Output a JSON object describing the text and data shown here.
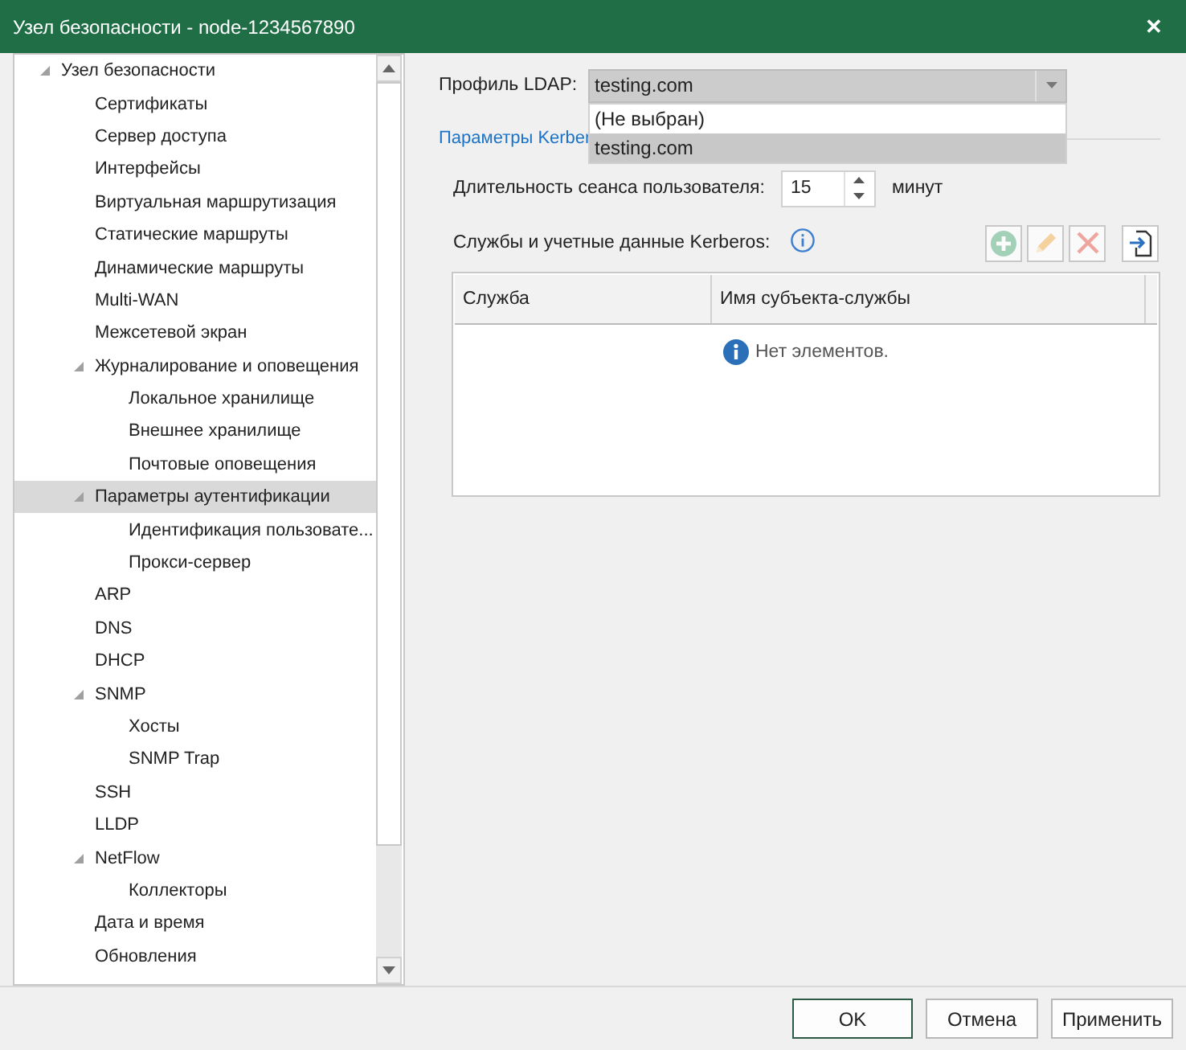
{
  "window": {
    "title": "Узел безопасности - node-1234567890",
    "close": "✕"
  },
  "tree": [
    {
      "label": "Узел безопасности",
      "expanded": true,
      "selected": false,
      "children": [
        {
          "label": "Сертификаты",
          "selected": false
        },
        {
          "label": "Сервер доступа",
          "selected": false
        },
        {
          "label": "Интерфейсы",
          "selected": false
        },
        {
          "label": "Виртуальная маршрутизация",
          "selected": false
        },
        {
          "label": "Статические маршруты",
          "selected": false
        },
        {
          "label": "Динамические маршруты",
          "selected": false
        },
        {
          "label": "Multi-WAN",
          "selected": false
        },
        {
          "label": "Межсетевой экран",
          "selected": false
        },
        {
          "label": "Журналирование и оповещения",
          "expanded": true,
          "selected": false,
          "children": [
            {
              "label": "Локальное хранилище",
              "selected": false
            },
            {
              "label": "Внешнее хранилище",
              "selected": false
            },
            {
              "label": "Почтовые оповещения",
              "selected": false
            }
          ]
        },
        {
          "label": "Параметры аутентификации",
          "expanded": true,
          "selected": true,
          "children": [
            {
              "label": "Идентификация пользовате...",
              "selected": false
            },
            {
              "label": "Прокси-сервер",
              "selected": false
            }
          ]
        },
        {
          "label": "ARP",
          "selected": false
        },
        {
          "label": "DNS",
          "selected": false
        },
        {
          "label": "DHCP",
          "selected": false
        },
        {
          "label": "SNMP",
          "expanded": true,
          "selected": false,
          "children": [
            {
              "label": "Хосты",
              "selected": false
            },
            {
              "label": "SNMP Trap",
              "selected": false
            }
          ]
        },
        {
          "label": "SSH",
          "selected": false
        },
        {
          "label": "LLDP",
          "selected": false
        },
        {
          "label": "NetFlow",
          "expanded": true,
          "selected": false,
          "children": [
            {
              "label": "Коллекторы",
              "selected": false
            }
          ]
        },
        {
          "label": "Дата и время",
          "selected": false
        },
        {
          "label": "Обновления",
          "selected": false
        }
      ]
    }
  ],
  "ldap": {
    "label": "Профиль LDAP:",
    "value": "testing.com",
    "options": [
      {
        "label": "(Не выбран)",
        "selected": false
      },
      {
        "label": "testing.com",
        "selected": true
      }
    ]
  },
  "kerberos": {
    "heading": "Параметры Kerber",
    "session": {
      "label": "Длительность сеанса пользователя:",
      "value": "15",
      "unit": "минут"
    },
    "services": {
      "label": "Службы и учетные данные Kerberos:",
      "tools": [
        {
          "kind": "add",
          "disabled": true
        },
        {
          "kind": "edit",
          "disabled": true
        },
        {
          "kind": "delete",
          "disabled": true
        },
        {
          "kind": "import",
          "disabled": false
        }
      ],
      "columns": [
        "Служба",
        "Имя субъекта-службы"
      ],
      "empty": "Нет элементов."
    }
  },
  "buttons": [
    {
      "label": "OK",
      "default": true
    },
    {
      "label": "Отмена",
      "default": false
    },
    {
      "label": "Применить",
      "default": false
    }
  ]
}
